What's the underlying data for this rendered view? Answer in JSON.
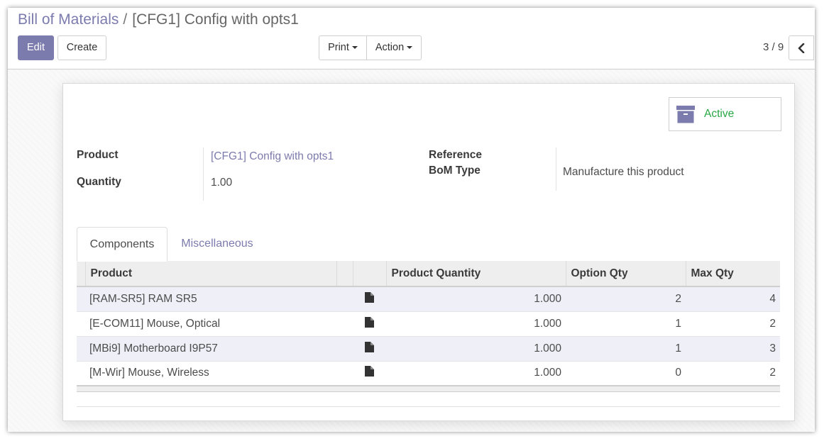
{
  "breadcrumb": {
    "parent": "Bill of Materials",
    "separator": "/",
    "current": "[CFG1] Config with opts1"
  },
  "toolbar": {
    "edit_label": "Edit",
    "create_label": "Create",
    "print_label": "Print",
    "action_label": "Action"
  },
  "pager": {
    "value": "3 / 9"
  },
  "status_button": {
    "label": "Active",
    "icon": "archive-icon"
  },
  "form": {
    "product_label": "Product",
    "product_value": "[CFG1] Config with opts1",
    "quantity_label": "Quantity",
    "quantity_value": "1.00",
    "reference_label": "Reference",
    "bom_type_label": "BoM Type",
    "bom_type_value": "Manufacture this product"
  },
  "tabs": [
    {
      "label": "Components",
      "active": true
    },
    {
      "label": "Miscellaneous",
      "active": false
    }
  ],
  "components_table": {
    "headers": [
      "Product",
      "",
      "",
      "Product Quantity",
      "Option Qty",
      "Max Qty"
    ],
    "rows": [
      {
        "product": "[RAM-SR5] RAM SR5",
        "qty": "1.000",
        "option_qty": "2",
        "max_qty": "4"
      },
      {
        "product": "[E-COM11] Mouse, Optical",
        "qty": "1.000",
        "option_qty": "1",
        "max_qty": "2"
      },
      {
        "product": "[MBi9] Motherboard I9P57",
        "qty": "1.000",
        "option_qty": "1",
        "max_qty": "3"
      },
      {
        "product": "[M-Wir] Mouse, Wireless",
        "qty": "1.000",
        "option_qty": "0",
        "max_qty": "2"
      }
    ]
  },
  "colors": {
    "brand": "#7c7bad",
    "active_green": "#28a745",
    "row_stripe": "#eeeff7"
  }
}
